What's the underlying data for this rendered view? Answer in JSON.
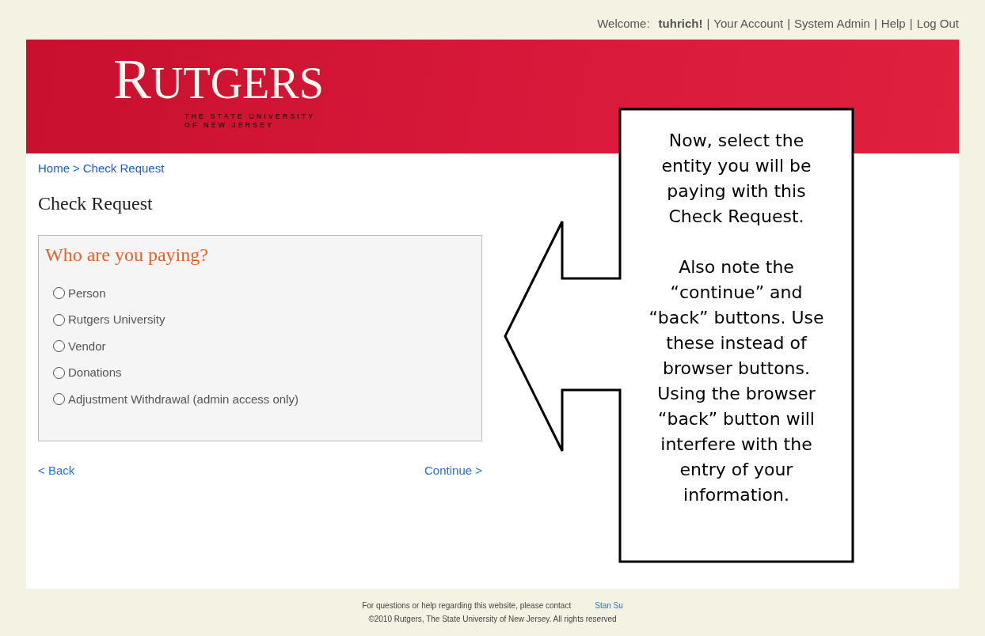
{
  "top_bar": {
    "welcome": "Welcome:",
    "user": "tuhrich!",
    "links": [
      {
        "separator": "|",
        "label": "Your Account"
      },
      {
        "separator": "|",
        "label": "System Admin"
      },
      {
        "separator": "|",
        "label": "Help"
      },
      {
        "separator": "|",
        "label": "Log Out"
      }
    ]
  },
  "banner": {
    "logo_initial": "R",
    "logo_rest": "UTGERS",
    "tagline_lines": [
      "THE STATE UNIVERSITY",
      "OF NEW JERSEY"
    ]
  },
  "breadcrumb": {
    "items": [
      "Home",
      "Check Request"
    ],
    "separator": ">"
  },
  "page_title": "Check Request",
  "panel": {
    "heading": "Who are you paying?",
    "options": [
      {
        "label": "Person",
        "selected": false
      },
      {
        "label": "Rutgers University",
        "selected": false
      },
      {
        "label": "Vendor",
        "selected": false
      },
      {
        "label": "Donations",
        "selected": false
      },
      {
        "label": "Adjustment Withdrawal (admin access only)",
        "selected": false
      }
    ]
  },
  "nav": {
    "back": "< Back",
    "continue": "Continue >"
  },
  "callout": {
    "paragraphs": [
      "Now, select the entity you will be paying with this Check Request.",
      "Also note the “continue” and “back” buttons. Use these instead of browser buttons. Using the browser “back” button will interfere with the entry of your information."
    ]
  },
  "footer": {
    "contact_text": "For questions or help regarding this website, please contact",
    "contact_link": "Stan Su",
    "copyright": "©2010 Rutgers, The State University of New Jersey. All rights reserved"
  }
}
